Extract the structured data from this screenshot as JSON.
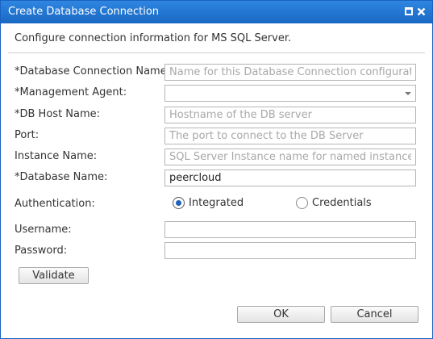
{
  "dialog": {
    "title": "Create Database Connection",
    "maximize_icon": "maximize-icon",
    "close_icon": "close-icon",
    "description": "Configure connection information for MS SQL Server."
  },
  "fields": {
    "connection_name": {
      "label": "*Database Connection Name:",
      "value": "",
      "placeholder": "Name for this Database Connection configuration"
    },
    "management_agent": {
      "label": "*Management Agent:",
      "value": ""
    },
    "host_name": {
      "label": "*DB Host Name:",
      "value": "",
      "placeholder": "Hostname of the DB server"
    },
    "port": {
      "label": "Port:",
      "value": "",
      "placeholder": "The port to connect to the DB Server"
    },
    "instance_name": {
      "label": "Instance Name:",
      "value": "",
      "placeholder": "SQL Server Instance name for named instance"
    },
    "database_name": {
      "label": "*Database Name:",
      "value": "peercloud",
      "placeholder": ""
    },
    "authentication": {
      "label": "Authentication:",
      "options": [
        "Integrated",
        "Credentials"
      ],
      "selected": "Integrated"
    },
    "username": {
      "label": "Username:",
      "value": ""
    },
    "password": {
      "label": "Password:",
      "value": ""
    }
  },
  "buttons": {
    "validate": "Validate",
    "ok": "OK",
    "cancel": "Cancel"
  },
  "colors": {
    "titlebar": "#1f6fcf",
    "radio_dot": "#1f5fb8"
  }
}
